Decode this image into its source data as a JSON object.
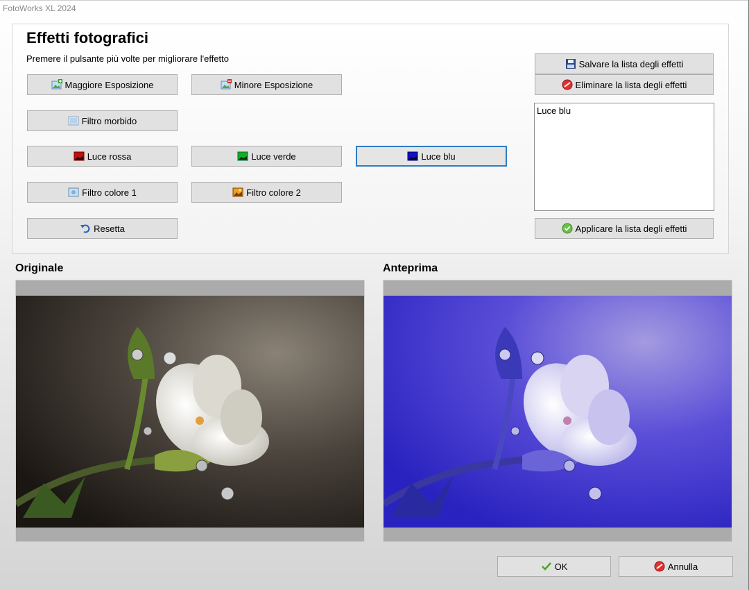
{
  "window": {
    "title": "FotoWorks XL 2024"
  },
  "panel": {
    "title": "Effetti fotografici",
    "subtitle": "Premere il pulsante più volte per migliorare l'effetto"
  },
  "effects": {
    "more_exposure": "Maggiore Esposizione",
    "less_exposure": "Minore Esposizione",
    "soft_filter": "Filtro morbido",
    "red_light": "Luce rossa",
    "green_light": "Luce verde",
    "blue_light": "Luce blu",
    "color_filter_1": "Filtro colore 1",
    "color_filter_2": "Filtro colore 2",
    "reset": "Resetta"
  },
  "effect_list": {
    "save_label": "Salvare la lista degli effetti",
    "delete_label": "Eliminare la lista degli effetti",
    "apply_label": "Applicare la lista degli effetti",
    "items": [
      "Luce blu"
    ]
  },
  "original": {
    "label": "Originale"
  },
  "preview": {
    "label": "Anteprima"
  },
  "footer": {
    "ok_label": "OK",
    "cancel_label": "Annulla"
  },
  "colors": {
    "focus_border": "#2f7bbf",
    "button_bg": "#e1e1e1",
    "red_swatch": "#c01010",
    "green_swatch": "#10b020",
    "blue_swatch": "#1010c8"
  },
  "icons": {
    "more_exposure": "photo-plus-icon",
    "less_exposure": "photo-minus-icon",
    "soft_filter": "soft-filter-icon",
    "red_light": "red-light-icon",
    "green_light": "green-light-icon",
    "blue_light": "blue-light-icon",
    "color_filter_1": "color-filter-1-icon",
    "color_filter_2": "color-filter-2-icon",
    "reset": "undo-icon",
    "save": "floppy-disk-icon",
    "delete": "delete-circle-icon",
    "apply": "check-circle-icon",
    "ok": "checkmark-icon",
    "cancel": "cancel-icon"
  }
}
